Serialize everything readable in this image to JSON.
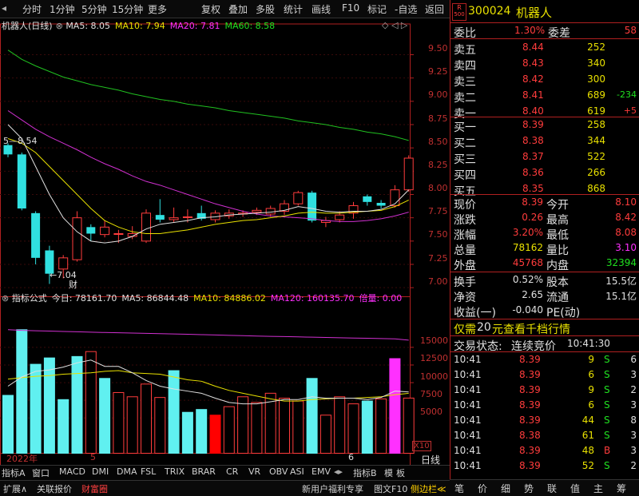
{
  "toolbar": {
    "left_items": [
      "分时",
      "1分钟",
      "5分钟",
      "15分钟",
      "更多"
    ],
    "right_items": [
      "复权",
      "叠加",
      "多股",
      "统计",
      "画线",
      "F10",
      "标记",
      "-自选",
      "返回"
    ]
  },
  "chart": {
    "title": "机器人(日线)",
    "ma_labels": [
      {
        "text": "MA5: 8.05",
        "color": "#e0e0e0"
      },
      {
        "text": "MA10: 7.94",
        "color": "#e8e000"
      },
      {
        "text": "MA20: 7.81",
        "color": "#ff30ff"
      },
      {
        "text": "MA60: 8.58",
        "color": "#20e020"
      }
    ],
    "y_ticks": [
      "9.50",
      "9.25",
      "9.00",
      "8.75",
      "8.50",
      "8.25",
      "8.00",
      "7.75",
      "7.50",
      "7.25",
      "7.00"
    ],
    "high_label": "8.54",
    "low_label": "7.04",
    "cai_label": "财",
    "candles": [
      {
        "o": 8.53,
        "c": 8.43,
        "h": 8.55,
        "l": 8.4
      },
      {
        "o": 8.43,
        "c": 7.85,
        "h": 8.45,
        "l": 7.83
      },
      {
        "o": 7.8,
        "c": 7.32,
        "h": 7.82,
        "l": 7.25
      },
      {
        "o": 7.4,
        "c": 7.15,
        "h": 7.45,
        "l": 7.04
      },
      {
        "o": 7.2,
        "c": 7.32,
        "h": 7.35,
        "l": 7.1
      },
      {
        "o": 7.3,
        "c": 7.75,
        "h": 7.82,
        "l": 7.28
      },
      {
        "o": 7.65,
        "c": 7.58,
        "h": 7.68,
        "l": 7.5
      },
      {
        "o": 7.57,
        "c": 7.65,
        "h": 7.72,
        "l": 7.54
      },
      {
        "o": 7.58,
        "c": 7.58,
        "h": 7.62,
        "l": 7.48
      },
      {
        "o": 7.55,
        "c": 7.58,
        "h": 7.66,
        "l": 7.52
      },
      {
        "o": 7.5,
        "c": 7.8,
        "h": 7.84,
        "l": 7.48
      },
      {
        "o": 7.78,
        "c": 7.73,
        "h": 7.95,
        "l": 7.7
      },
      {
        "o": 7.73,
        "c": 7.75,
        "h": 7.86,
        "l": 7.7
      },
      {
        "o": 7.76,
        "c": 7.76,
        "h": 7.84,
        "l": 7.7
      },
      {
        "o": 7.8,
        "c": 7.74,
        "h": 7.88,
        "l": 7.72
      },
      {
        "o": 7.73,
        "c": 7.8,
        "h": 7.83,
        "l": 7.7
      },
      {
        "o": 7.77,
        "c": 7.8,
        "h": 7.84,
        "l": 7.74
      },
      {
        "o": 7.79,
        "c": 7.8,
        "h": 7.83,
        "l": 7.76
      },
      {
        "o": 7.81,
        "c": 7.83,
        "h": 7.86,
        "l": 7.78
      },
      {
        "o": 7.79,
        "c": 7.85,
        "h": 7.88,
        "l": 7.76
      },
      {
        "o": 7.82,
        "c": 7.9,
        "h": 7.94,
        "l": 7.78
      },
      {
        "o": 7.9,
        "c": 8.02,
        "h": 8.04,
        "l": 7.88
      },
      {
        "o": 8.02,
        "c": 7.72,
        "h": 8.04,
        "l": 7.7
      },
      {
        "o": 7.7,
        "c": 7.72,
        "h": 7.76,
        "l": 7.65
      },
      {
        "o": 7.73,
        "c": 7.78,
        "h": 7.82,
        "l": 7.7
      },
      {
        "o": 7.8,
        "c": 7.88,
        "h": 7.92,
        "l": 7.74
      },
      {
        "o": 7.98,
        "c": 7.92,
        "h": 8.0,
        "l": 7.88
      },
      {
        "o": 7.91,
        "c": 7.88,
        "h": 7.94,
        "l": 7.85
      },
      {
        "o": 7.88,
        "c": 8.05,
        "h": 8.1,
        "l": 7.86
      },
      {
        "o": 8.05,
        "c": 8.39,
        "h": 8.42,
        "l": 8.03
      }
    ],
    "ma5": [
      8.75,
      8.6,
      8.3,
      8.0,
      7.75,
      7.6,
      7.5,
      7.48,
      7.5,
      7.55,
      7.63,
      7.68,
      7.7,
      7.72,
      7.75,
      7.76,
      7.78,
      7.79,
      7.8,
      7.81,
      7.83,
      7.87,
      7.85,
      7.82,
      7.81,
      7.82,
      7.82,
      7.84,
      7.9,
      8.05
    ],
    "ma10": [
      8.6,
      8.55,
      8.45,
      8.3,
      8.15,
      8.0,
      7.85,
      7.72,
      7.65,
      7.6,
      7.58,
      7.58,
      7.6,
      7.62,
      7.65,
      7.68,
      7.7,
      7.72,
      7.73,
      7.75,
      7.77,
      7.8,
      7.81,
      7.8,
      7.8,
      7.81,
      7.82,
      7.83,
      7.87,
      7.94
    ],
    "ma20": [
      8.9,
      8.8,
      8.7,
      8.62,
      8.55,
      8.48,
      8.4,
      8.33,
      8.27,
      8.2,
      8.14,
      8.1,
      8.05,
      8.0,
      7.95,
      7.9,
      7.86,
      7.82,
      7.79,
      7.77,
      7.76,
      7.75,
      7.74,
      7.72,
      7.71,
      7.71,
      7.72,
      7.74,
      7.77,
      7.81
    ],
    "ma60": [
      9.55,
      9.45,
      9.38,
      9.32,
      9.26,
      9.22,
      9.18,
      9.15,
      9.12,
      9.08,
      9.05,
      9.02,
      9.0,
      8.97,
      8.95,
      8.93,
      8.9,
      8.88,
      8.86,
      8.84,
      8.82,
      8.79,
      8.77,
      8.75,
      8.72,
      8.7,
      8.67,
      8.65,
      8.62,
      8.58
    ],
    "ymin": 6.92,
    "ymax": 9.68
  },
  "sub": {
    "title_parts": [
      {
        "text": "指标公式",
        "color": "#e0e0e0"
      },
      {
        "text": "今日: 78161.70",
        "color": "#e0e0e0"
      },
      {
        "text": "MA5: 86844.48",
        "color": "#e0e0e0"
      },
      {
        "text": "MA10: 84886.02",
        "color": "#e8e000"
      },
      {
        "text": "MA120: 160135.70",
        "color": "#ff30ff"
      },
      {
        "text": "倍量: 0.00",
        "color": "#ff30ff"
      }
    ],
    "y_ticks": [
      "15000",
      "12500",
      "10000",
      "7500",
      "5000"
    ],
    "unit": "X10",
    "vol": [
      8200,
      17500,
      12600,
      13500,
      7600,
      13700,
      14400,
      10600,
      8600,
      8000,
      9800,
      7900,
      11700,
      5800,
      6200,
      5400,
      6600,
      8000,
      7200,
      8500,
      7800,
      7400,
      10600,
      5400,
      8000,
      7000,
      7400,
      7700,
      13400,
      7816
    ],
    "vol_color": [
      "c",
      "c",
      "c",
      "c",
      "c",
      "c",
      "r",
      "c",
      "r",
      "r",
      "r",
      "r",
      "c",
      "c",
      "c",
      "rf",
      "r",
      "r",
      "r",
      "r",
      "r",
      "r",
      "c",
      "r",
      "r",
      "r",
      "c",
      "r",
      "m",
      "r"
    ],
    "ma5": [
      9500,
      10800,
      11600,
      11800,
      12200,
      12800,
      13200,
      12300,
      12300,
      11400,
      10300,
      9500,
      9100,
      8800,
      8500,
      7800,
      7200,
      7000,
      7000,
      7300,
      7600,
      7600,
      8000,
      7800,
      7800,
      7800,
      7600,
      7900,
      8800,
      8684
    ],
    "ma10": [
      10500,
      10700,
      10900,
      11000,
      11200,
      11300,
      11400,
      11600,
      11700,
      11400,
      11300,
      11200,
      10800,
      10400,
      10200,
      9500,
      8900,
      8500,
      8100,
      7700,
      7400,
      7400,
      7600,
      7700,
      7800,
      7800,
      7900,
      8000,
      8300,
      8489
    ],
    "ma120": [
      17500,
      17400,
      17350,
      17300,
      17250,
      17200,
      17150,
      17100,
      17060,
      17020,
      16980,
      16940,
      16900,
      16850,
      16800,
      16750,
      16700,
      16650,
      16600,
      16560,
      16520,
      16480,
      16440,
      16400,
      16360,
      16320,
      16280,
      16240,
      16200,
      16014
    ],
    "vmax": 19000,
    "x_labels": [
      {
        "text": "2022年",
        "color": "#c03030"
      },
      {
        "text": "5",
        "color": "#c03030"
      },
      {
        "text": "6",
        "color": "#e0e0e0"
      }
    ],
    "right_label": "日线"
  },
  "tabs": [
    "指标A",
    "窗口",
    "MACD",
    "DMI",
    "DMA",
    "FSL",
    "TRIX",
    "BRAR",
    "CR",
    "VR",
    "OBV",
    "ASI",
    "EMV"
  ],
  "tabs_right": [
    "指标B",
    "模",
    "板"
  ],
  "status": {
    "left": [
      "扩展∧",
      "关联报价",
      "财富圈"
    ],
    "right": [
      "新用户福利专享",
      "图文F10",
      "侧边栏≪"
    ]
  },
  "quote": {
    "badge_r": "R",
    "badge_num": "500",
    "code": "300024",
    "name": "机器人",
    "webi_label": "委比",
    "webi": "1.30%",
    "weicha_label": "委差",
    "weicha": "58",
    "asks": [
      {
        "label": "卖五",
        "price": "8.44",
        "vol": "252",
        "chg": ""
      },
      {
        "label": "卖四",
        "price": "8.43",
        "vol": "340",
        "chg": ""
      },
      {
        "label": "卖三",
        "price": "8.42",
        "vol": "300",
        "chg": ""
      },
      {
        "label": "卖二",
        "price": "8.41",
        "vol": "689",
        "chg": "-234"
      },
      {
        "label": "卖一",
        "price": "8.40",
        "vol": "619",
        "chg": "+5"
      }
    ],
    "bids": [
      {
        "label": "买一",
        "price": "8.39",
        "vol": "258"
      },
      {
        "label": "买二",
        "price": "8.38",
        "vol": "344"
      },
      {
        "label": "买三",
        "price": "8.37",
        "vol": "522"
      },
      {
        "label": "买四",
        "price": "8.36",
        "vol": "266"
      },
      {
        "label": "买五",
        "price": "8.35",
        "vol": "868"
      }
    ],
    "stats": [
      {
        "l1": "现价",
        "v1": "8.39",
        "c1": "red",
        "l2": "今开",
        "v2": "8.10",
        "c2": "red"
      },
      {
        "l1": "涨跌",
        "v1": "0.26",
        "c1": "red",
        "l2": "最高",
        "v2": "8.42",
        "c2": "red"
      },
      {
        "l1": "涨幅",
        "v1": "3.20%",
        "c1": "red",
        "l2": "最低",
        "v2": "8.08",
        "c2": "red"
      },
      {
        "l1": "总量",
        "v1": "78162",
        "c1": "yel",
        "l2": "量比",
        "v2": "3.10",
        "c2": "mag"
      },
      {
        "l1": "外盘",
        "v1": "45768",
        "c1": "red",
        "l2": "内盘",
        "v2": "32394",
        "c2": "grn"
      }
    ],
    "stats2": [
      {
        "l1": "换手",
        "v1": "0.52%",
        "l2": "股本",
        "v2": "15.5亿"
      },
      {
        "l1": "净资",
        "v1": "2.65",
        "l2": "流通",
        "v2": "15.1亿"
      },
      {
        "l1": "收益(一)",
        "v1": "-0.040",
        "l2": "PE(动)",
        "v2": ""
      }
    ],
    "promo_a": "仅需",
    "promo_b": "20",
    "promo_c": "元查看千档行情",
    "trade_label": "交易状态:",
    "trade_state": "连续竞价",
    "trade_time": "10:41:30",
    "ticks": [
      {
        "t": "10:41",
        "p": "8.39",
        "v": "9",
        "bs": "S",
        "n": "6"
      },
      {
        "t": "10:41",
        "p": "8.39",
        "v": "6",
        "bs": "S",
        "n": "3"
      },
      {
        "t": "10:41",
        "p": "8.39",
        "v": "9",
        "bs": "S",
        "n": "2"
      },
      {
        "t": "10:41",
        "p": "8.39",
        "v": "6",
        "bs": "S",
        "n": "3"
      },
      {
        "t": "10:41",
        "p": "8.39",
        "v": "44",
        "bs": "S",
        "n": "8"
      },
      {
        "t": "10:41",
        "p": "8.38",
        "v": "61",
        "bs": "S",
        "n": "3"
      },
      {
        "t": "10:41",
        "p": "8.39",
        "v": "48",
        "bs": "B",
        "n": "3"
      },
      {
        "t": "10:41",
        "p": "8.39",
        "v": "52",
        "bs": "S",
        "n": "2"
      }
    ],
    "bottom_icons": [
      "笔",
      "价",
      "细",
      "势",
      "联",
      "值",
      "主",
      "筹"
    ]
  }
}
